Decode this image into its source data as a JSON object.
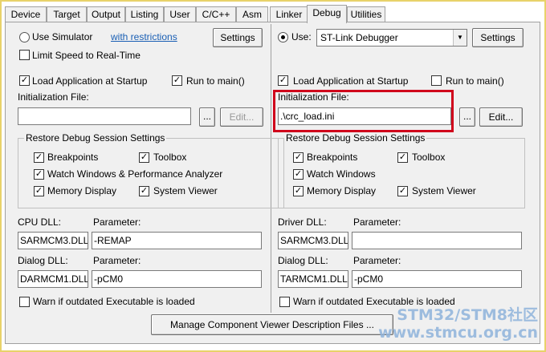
{
  "tabs": [
    "Device",
    "Target",
    "Output",
    "Listing",
    "User",
    "C/C++",
    "Asm",
    "Linker",
    "Debug",
    "Utilities"
  ],
  "active_tab": "Debug",
  "left": {
    "use_simulator": "Use Simulator",
    "with_restrictions": "with restrictions",
    "settings": "Settings",
    "limit_speed": "Limit Speed to Real-Time",
    "load_app": "Load Application at Startup",
    "run_to_main": "Run to main()",
    "init_file_label": "Initialization File:",
    "init_file_value": "",
    "browse": "...",
    "edit": "Edit...",
    "restore_group": "Restore Debug Session Settings",
    "breakpoints": "Breakpoints",
    "toolbox": "Toolbox",
    "watch_windows": "Watch Windows & Performance Analyzer",
    "memory_display": "Memory Display",
    "system_viewer": "System Viewer",
    "cpu_dll_label": "CPU DLL:",
    "cpu_param_label": "Parameter:",
    "cpu_dll": "SARMCM3.DLL",
    "cpu_param": "-REMAP",
    "dialog_dll_label": "Dialog DLL:",
    "dialog_param_label": "Parameter:",
    "dialog_dll": "DARMCM1.DLL",
    "dialog_param": "-pCM0",
    "warn": "Warn if outdated Executable is loaded"
  },
  "right": {
    "use": "Use:",
    "debugger": "ST-Link Debugger",
    "settings": "Settings",
    "load_app": "Load Application at Startup",
    "run_to_main": "Run to main()",
    "init_file_label": "Initialization File:",
    "init_file_value": ".\\crc_load.ini",
    "browse": "...",
    "edit": "Edit...",
    "restore_group": "Restore Debug Session Settings",
    "breakpoints": "Breakpoints",
    "toolbox": "Toolbox",
    "watch_windows": "Watch Windows",
    "memory_display": "Memory Display",
    "system_viewer": "System Viewer",
    "driver_dll_label": "Driver DLL:",
    "driver_param_label": "Parameter:",
    "driver_dll": "SARMCM3.DLL",
    "driver_param": "",
    "dialog_dll_label": "Dialog DLL:",
    "dialog_param_label": "Parameter:",
    "dialog_dll": "TARMCM1.DLL",
    "dialog_param": "-pCM0",
    "warn": "Warn if outdated Executable is loaded"
  },
  "manage_button": "Manage Component Viewer Description Files ...",
  "watermark": {
    "line1": "STM32/STM8社区",
    "line2": "www.stmcu.org.cn"
  },
  "colors": {
    "highlight": "#d0021b",
    "link": "#1a5fb4",
    "watermark": "#8fb4dc"
  }
}
